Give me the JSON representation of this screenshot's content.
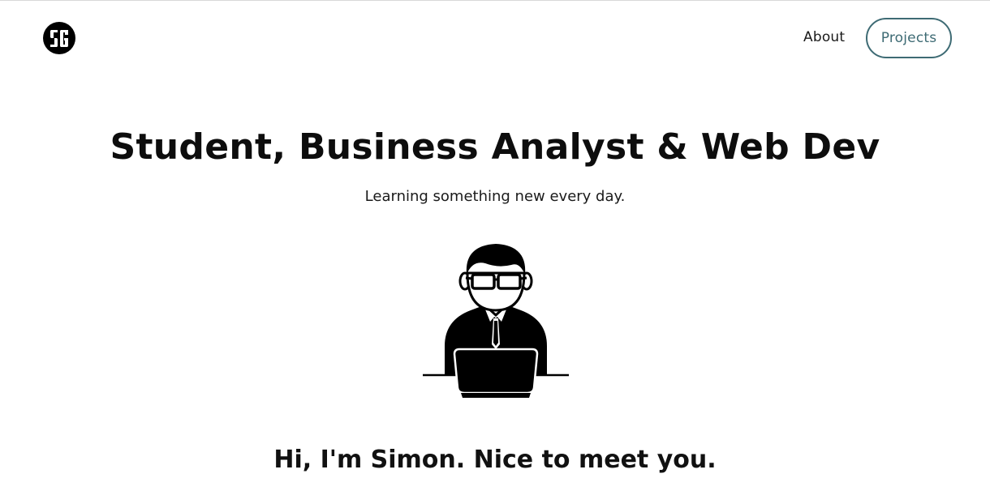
{
  "header": {
    "logo_text": "SG",
    "nav": {
      "about_label": "About",
      "projects_label": "Projects"
    }
  },
  "hero": {
    "title": "Student, Business Analyst & Web Dev",
    "subtitle": "Learning something new every day.",
    "illustration_icon": "developer-at-laptop-icon"
  },
  "intro": {
    "heading": "Hi, I'm Simon. Nice to meet you."
  },
  "colors": {
    "accent": "#3e6b74",
    "text": "#111111",
    "background": "#ffffff"
  }
}
